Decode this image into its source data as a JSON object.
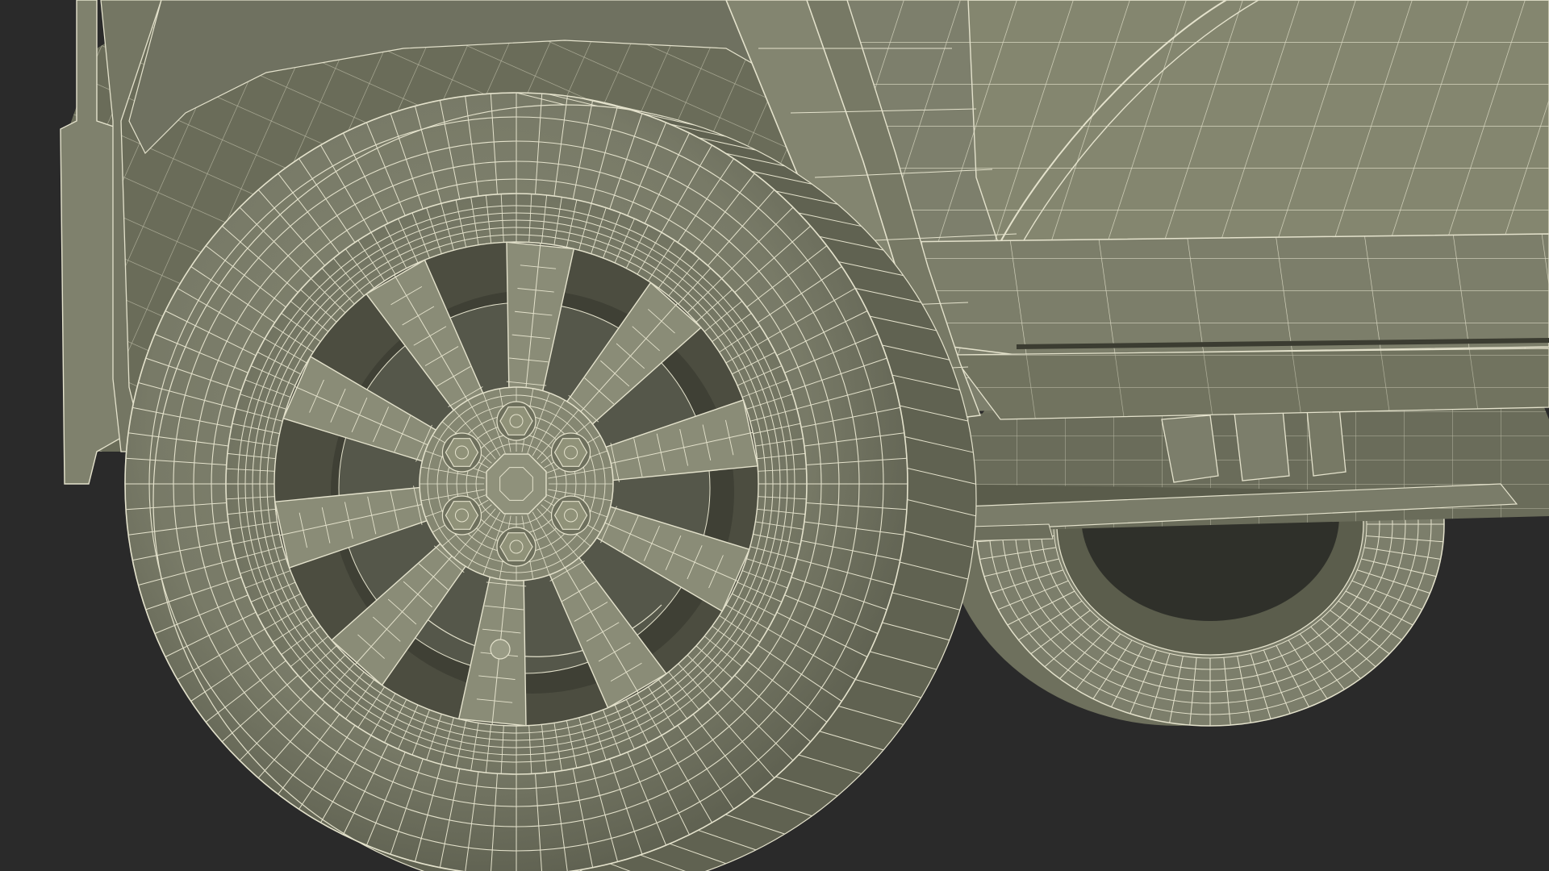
{
  "scene": {
    "subject": "car-rear-wheel-wireframe",
    "view": "low-angle-close-up"
  },
  "colors": {
    "background": "#2a2a2a",
    "surface": "#7d7f6c",
    "surface_light": "#8a8c78",
    "surface_dark": "#626452",
    "shadow": "#4a4b3e",
    "deep_shadow": "#35362c",
    "wire": "#e4e2cc",
    "wire_dim": "#c9c7b0"
  }
}
